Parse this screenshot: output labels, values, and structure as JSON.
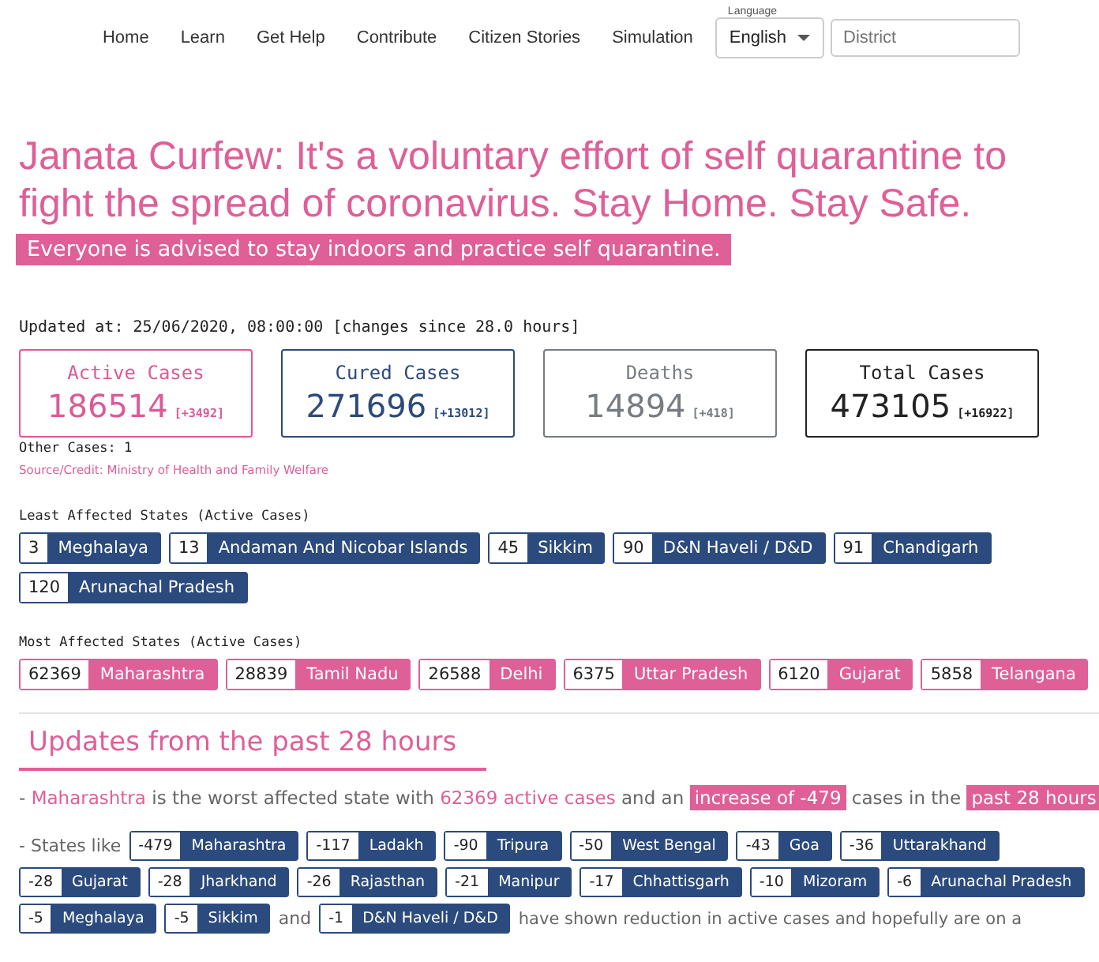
{
  "nav": {
    "links": [
      "Home",
      "Learn",
      "Get Help",
      "Contribute",
      "Citizen Stories",
      "Simulation"
    ],
    "language": {
      "label": "Language",
      "value": "English"
    },
    "district": {
      "placeholder": "District"
    }
  },
  "headline": "Janata Curfew: It's a voluntary effort of self quarantine to fight the spread of coronavirus. Stay Home. Stay Safe.",
  "banner": "Everyone is advised to stay indoors and practice self quarantine.",
  "updated": "Updated at: 25/06/2020, 08:00:00 [changes since 28.0 hours]",
  "stats": [
    {
      "kind": "active",
      "title": "Active Cases",
      "value": "186514",
      "delta": "[+3492]"
    },
    {
      "kind": "cured",
      "title": "Cured Cases",
      "value": "271696",
      "delta": "[+13012]"
    },
    {
      "kind": "deaths",
      "title": "Deaths",
      "value": "14894",
      "delta": "[+418]"
    },
    {
      "kind": "total",
      "title": "Total Cases",
      "value": "473105",
      "delta": "[+16922]"
    }
  ],
  "other_cases": "Other Cases: 1",
  "source": "Source/Credit: Ministry of Health and Family Welfare",
  "groups": [
    {
      "kind": "least",
      "title": "Least Affected States (Active Cases)",
      "items": [
        {
          "count": "3",
          "state": "Meghalaya"
        },
        {
          "count": "13",
          "state": "Andaman And Nicobar Islands"
        },
        {
          "count": "45",
          "state": "Sikkim"
        },
        {
          "count": "90",
          "state": "D&N Haveli / D&D"
        },
        {
          "count": "91",
          "state": "Chandigarh"
        },
        {
          "count": "120",
          "state": "Arunachal Pradesh"
        }
      ]
    },
    {
      "kind": "most",
      "title": "Most Affected States (Active Cases)",
      "items": [
        {
          "count": "62369",
          "state": "Maharashtra"
        },
        {
          "count": "28839",
          "state": "Tamil Nadu"
        },
        {
          "count": "26588",
          "state": "Delhi"
        },
        {
          "count": "6375",
          "state": "Uttar Pradesh"
        },
        {
          "count": "6120",
          "state": "Gujarat"
        },
        {
          "count": "5858",
          "state": "Telangana"
        }
      ]
    }
  ],
  "updates": {
    "heading": "Updates from the past 28 hours",
    "summary": [
      {
        "kind": "plain",
        "text": "- "
      },
      {
        "kind": "accent",
        "text": "Maharashtra"
      },
      {
        "kind": "plain",
        "text": " is the worst affected state with "
      },
      {
        "kind": "accent",
        "text": "62369 active cases"
      },
      {
        "kind": "plain",
        "text": " and an "
      },
      {
        "kind": "badge",
        "text": "increase of -479"
      },
      {
        "kind": "plain",
        "text": " cases in the "
      },
      {
        "kind": "badge",
        "text": "past 28 hours"
      }
    ],
    "states_intro": "- States like",
    "states": [
      {
        "count": "-479",
        "state": "Maharashtra"
      },
      {
        "count": "-117",
        "state": "Ladakh"
      },
      {
        "count": "-90",
        "state": "Tripura"
      },
      {
        "count": "-50",
        "state": "West Bengal"
      },
      {
        "count": "-43",
        "state": "Goa"
      },
      {
        "count": "-36",
        "state": "Uttarakhand"
      },
      {
        "count": "-28",
        "state": "Gujarat"
      },
      {
        "count": "-28",
        "state": "Jharkhand"
      },
      {
        "count": "-26",
        "state": "Rajasthan"
      },
      {
        "count": "-21",
        "state": "Manipur"
      },
      {
        "count": "-17",
        "state": "Chhattisgarh"
      },
      {
        "count": "-10",
        "state": "Mizoram"
      },
      {
        "count": "-6",
        "state": "Arunachal Pradesh"
      },
      {
        "count": "-5",
        "state": "Meghalaya"
      },
      {
        "count": "-5",
        "state": "Sikkim"
      }
    ],
    "connector": "and",
    "last_state": {
      "count": "-1",
      "state": "D&N Haveli / D&D"
    },
    "tail": "have shown reduction in active cases and hopefully are on a"
  }
}
